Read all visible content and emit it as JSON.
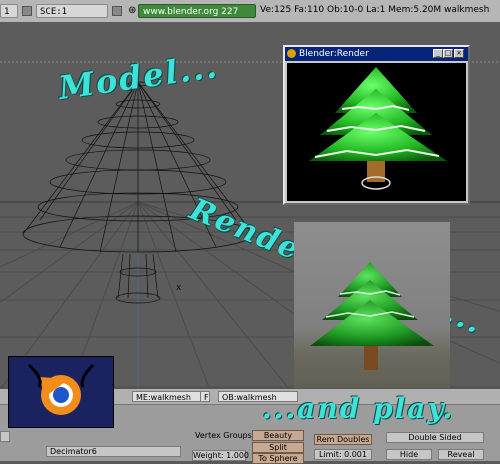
{
  "header": {
    "screen_field": "SCE:1",
    "left_field": "1",
    "url_label": "www.blender.org 227",
    "stats": "Ve:125 Fa:110  Ob:10-0 La:1  Mem:5.20M   walkmesh"
  },
  "overlay": {
    "model": "Model...",
    "render": "Render, maybe...",
    "play": "...and play."
  },
  "render_window": {
    "title": "Blender:Render",
    "minimize": "_",
    "maximize": "□",
    "close": "×"
  },
  "buttons_window": {
    "mesh_field": "ME:walkmesh",
    "f_label": "F",
    "object_field": "OB:walkmesh",
    "vertex_groups": "Vertex Groups",
    "beauty": "Beauty",
    "split": "Split",
    "to_sphere": "To Sphere",
    "rem_doubles": "Rem Doubles",
    "limit": "Limit: 0.001",
    "double_sided": "Double Sided",
    "hide": "Hide",
    "reveal": "Reveal",
    "weight": "Weight: 1.000",
    "decimator": "Decimator6"
  },
  "colors": {
    "overlay_text": "#3fe2d8",
    "render_title_bar": "#06247a",
    "viewport_bg": "#5a5a5a",
    "url_bar": "#3e8a3a"
  }
}
